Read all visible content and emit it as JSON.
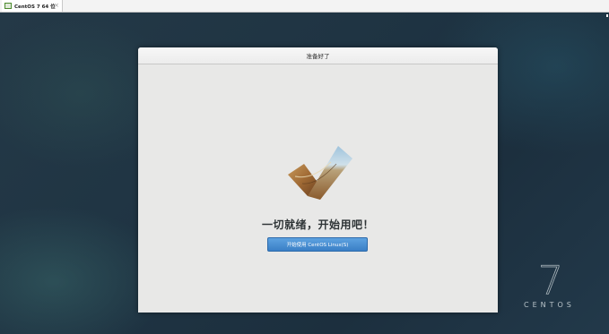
{
  "host": {
    "tab_label": "CentOS 7 64 位",
    "close_glyph": "×"
  },
  "installer": {
    "title": "准备好了",
    "heading": "一切就绪，开始用吧！",
    "start_button_label": "开始使用 CentOS Linux(S)"
  },
  "branding": {
    "version_glyph": "7",
    "word": "CENTOS"
  },
  "colors": {
    "button": "#3a7fc6",
    "window_bg": "#e8e8e7",
    "desktop_bg": "#1f3443"
  }
}
